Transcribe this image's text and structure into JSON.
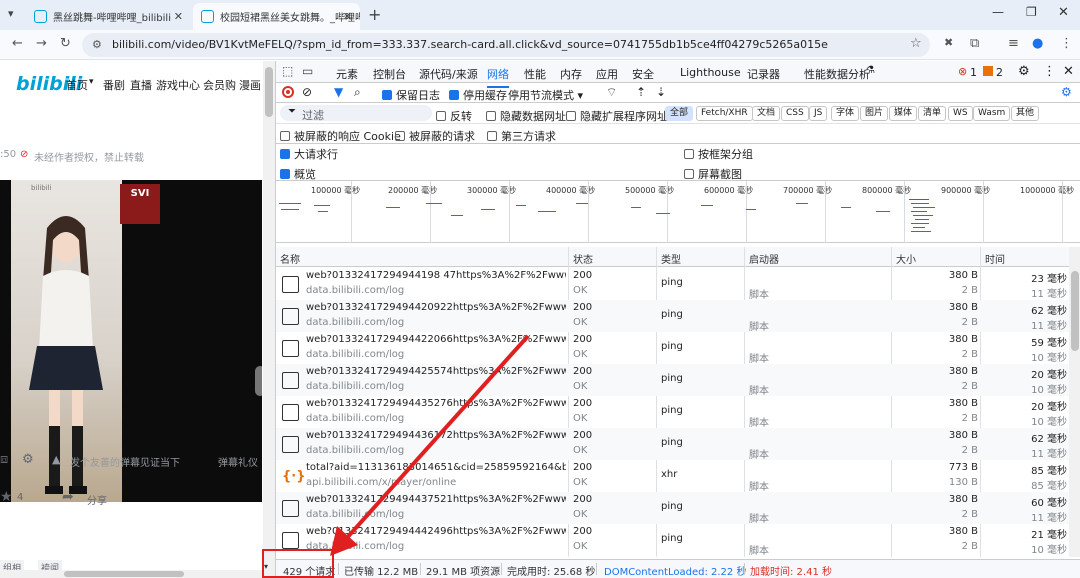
{
  "browser": {
    "tabs": [
      {
        "title": "黑丝跳舞-哔哩哔哩_bilibili",
        "active": false
      },
      {
        "title": "校园短裙黑丝美女跳舞。_哔哩哔",
        "active": true
      }
    ],
    "url": "bilibili.com/video/BV1KvtMeFELQ/?spm_id_from=333.337.search-card.all.click&vd_source=0741755db1b5ce4ff04279c5265a015e"
  },
  "page": {
    "logo": "bilibili",
    "nav": [
      "首页",
      "番剧",
      "直播",
      "游戏中心",
      "会员购",
      "漫画"
    ],
    "time_fragment": ":50",
    "notice": "未经作者授权，禁止转载",
    "video_watermark": "bilibili",
    "sign_text": "SVI",
    "danmaku_placeholder": "发个友善的弹幕见证当下",
    "danmaku_etiquette": "弹幕礼仪",
    "like_count": "4",
    "share_label": "分享",
    "bottom_tags": [
      "组相",
      "袴闻"
    ]
  },
  "devtools": {
    "panel_tabs": [
      "元素",
      "控制台",
      "源代码/来源",
      "网络",
      "性能",
      "内存",
      "应用",
      "安全",
      "Lighthouse",
      "记录器",
      "性能数据分析"
    ],
    "active_tab": "网络",
    "error_count": "1",
    "warning_count": "2",
    "toolbar": {
      "preserve_log": "保留日志",
      "disable_cache": "停用缓存",
      "throttle": "停用节流模式"
    },
    "filter": {
      "placeholder": "过滤",
      "invert": "反转",
      "hide_data_urls": "隐藏数据网址",
      "hide_extension_urls": "隐藏扩展程序网址",
      "types": [
        "全部",
        "Fetch/XHR",
        "文档",
        "CSS",
        "JS",
        "字体",
        "图片",
        "媒体",
        "清单",
        "WS",
        "Wasm",
        "其他"
      ],
      "blocked_cookies": "被屏蔽的响应 Cookie",
      "blocked_requests": "被屏蔽的请求",
      "third_party": "第三方请求"
    },
    "settings": {
      "big_rows": "大请求行",
      "group_by_frame": "按框架分组",
      "overview": "概览",
      "screenshots": "屏幕截图"
    },
    "overview_ticks": [
      "100000 毫秒",
      "200000 毫秒",
      "300000 毫秒",
      "400000 毫秒",
      "500000 毫秒",
      "600000 毫秒",
      "700000 毫秒",
      "800000 毫秒",
      "900000 毫秒",
      "1000000 毫秒"
    ],
    "columns": [
      "名称",
      "状态",
      "类型",
      "启动器",
      "大小",
      "时间"
    ],
    "rows": [
      {
        "name": "web?01332417294944198 47https%3A%2F%2Fwww.bilibi...",
        "domain": "data.bilibili.com/log",
        "status": "200",
        "status_text": "OK",
        "type": "ping",
        "initiator": "脚本",
        "size": "380 B",
        "size2": "2 B",
        "time": "23 毫秒",
        "time2": "11 毫秒"
      },
      {
        "name": "web?0133241729494420922https%3A%2F%2Fwww.bilibi...",
        "domain": "data.bilibili.com/log",
        "status": "200",
        "status_text": "OK",
        "type": "ping",
        "initiator": "脚本",
        "size": "380 B",
        "size2": "2 B",
        "time": "62 毫秒",
        "time2": "11 毫秒"
      },
      {
        "name": "web?0133241729494422066https%3A%2F%2Fwww.bilibi...",
        "domain": "data.bilibili.com/log",
        "status": "200",
        "status_text": "OK",
        "type": "ping",
        "initiator": "脚本",
        "size": "380 B",
        "size2": "2 B",
        "time": "59 毫秒",
        "time2": "10 毫秒"
      },
      {
        "name": "web?0133241729494425574https%3A%2F%2Fwww.bilibi...",
        "domain": "data.bilibili.com/log",
        "status": "200",
        "status_text": "OK",
        "type": "ping",
        "initiator": "脚本",
        "size": "380 B",
        "size2": "2 B",
        "time": "20 毫秒",
        "time2": "10 毫秒"
      },
      {
        "name": "web?0133241729494435276https%3A%2F%2Fwww.bilibi...",
        "domain": "data.bilibili.com/log",
        "status": "200",
        "status_text": "OK",
        "type": "ping",
        "initiator": "脚本",
        "size": "380 B",
        "size2": "2 B",
        "time": "20 毫秒",
        "time2": "10 毫秒"
      },
      {
        "name": "web?0133241729494436172https%3A%2F%2Fwww.bilibi...",
        "domain": "data.bilibili.com/log",
        "status": "200",
        "status_text": "OK",
        "type": "ping",
        "initiator": "脚本",
        "size": "380 B",
        "size2": "2 B",
        "time": "62 毫秒",
        "time2": "11 毫秒"
      },
      {
        "name": "total?aid=113136183014651&cid=25859592164&bvid=...",
        "domain": "api.bilibili.com/x/player/online",
        "status": "200",
        "status_text": "OK",
        "type": "xhr",
        "initiator": "脚本",
        "size": "773 B",
        "size2": "130 B",
        "time": "85 毫秒",
        "time2": "85 毫秒"
      },
      {
        "name": "web?0133241729494437521https%3A%2F%2Fwww.bilibi...",
        "domain": "data.bilibili.com/log",
        "status": "200",
        "status_text": "OK",
        "type": "ping",
        "initiator": "脚本",
        "size": "380 B",
        "size2": "2 B",
        "time": "60 毫秒",
        "time2": "11 毫秒"
      },
      {
        "name": "web?0133241729494442496https%3A%2F%2Fwww.bilibi...",
        "domain": "data.bilibili.com/log",
        "status": "200",
        "status_text": "OK",
        "type": "ping",
        "initiator": "脚本",
        "size": "380 B",
        "size2": "2 B",
        "time": "21 毫秒",
        "time2": "10 毫秒"
      }
    ],
    "status_bar": {
      "requests": "429 个请求",
      "transferred": "已传输 12.2 MB",
      "resources": "29.1 MB 项资源",
      "finish": "完成用时: 25.68 秒",
      "dcl": "DOMContentLoaded: 2.22 秒",
      "load": "加载时间: 2.41 秒"
    },
    "colors": {
      "accent": "#1a73e8",
      "annotation": "#e02020",
      "load": "#d93025"
    }
  }
}
